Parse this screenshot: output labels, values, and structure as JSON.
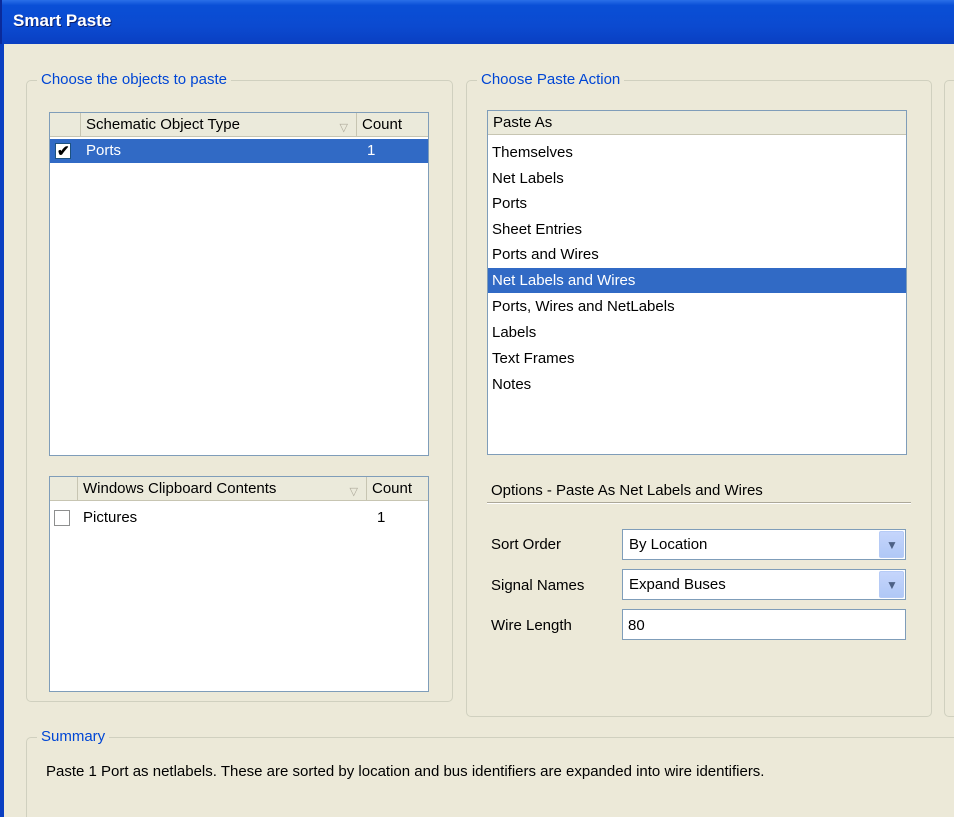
{
  "window": {
    "title": "Smart Paste"
  },
  "objects_group": {
    "legend": "Choose the objects to paste",
    "schematic_table": {
      "headers": {
        "type": "Schematic Object Type",
        "count": "Count"
      },
      "rows": [
        {
          "checked": true,
          "label": "Ports",
          "count": "1"
        }
      ]
    },
    "clipboard_table": {
      "headers": {
        "type": "Windows Clipboard Contents",
        "count": "Count"
      },
      "rows": [
        {
          "checked": false,
          "label": "Pictures",
          "count": "1"
        }
      ]
    }
  },
  "action_group": {
    "legend": "Choose Paste Action",
    "paste_as_header": "Paste As",
    "paste_as_items": [
      "Themselves",
      "Net Labels",
      "Ports",
      "Sheet Entries",
      "Ports and Wires",
      "Net Labels and Wires",
      "Ports, Wires and NetLabels",
      "Labels",
      "Text Frames",
      "Notes"
    ],
    "selected_item": "Net Labels and Wires",
    "options": {
      "title": "Options - Paste As Net Labels and Wires",
      "sort_order_label": "Sort Order",
      "sort_order_value": "By Location",
      "signal_names_label": "Signal Names",
      "signal_names_value": "Expand Buses",
      "wire_length_label": "Wire Length",
      "wire_length_value": "80"
    }
  },
  "summary": {
    "legend": "Summary",
    "text": "Paste 1 Port as netlabels. These are sorted by location and bus identifiers are expanded into wire identifiers."
  },
  "colors": {
    "titlebar": "#0b4ad0",
    "selection": "#316ac5",
    "legend_text": "#0046d5",
    "dialog_bg": "#ece9d8"
  },
  "icons": [
    "checkbox-checked-icon",
    "checkbox-unchecked-icon",
    "sort-triangle-icon",
    "dropdown-arrow-icon"
  ]
}
